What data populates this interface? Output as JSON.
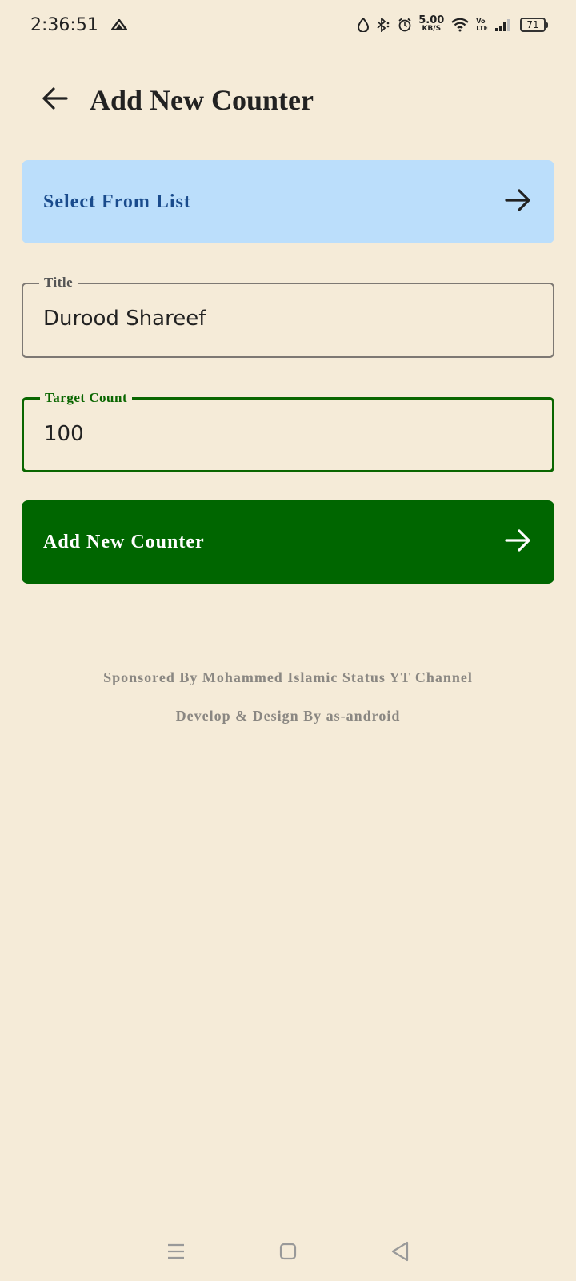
{
  "status_bar": {
    "time": "2:36:51",
    "net_speed_value": "5.00",
    "net_speed_unit": "KB/S",
    "volte_top": "Vo",
    "volte_bottom": "LTE",
    "battery": "71"
  },
  "app_bar": {
    "title": "Add New Counter",
    "back_icon": "arrow-left-icon"
  },
  "select_list": {
    "label": "Select From List",
    "icon": "arrow-right-icon"
  },
  "form": {
    "title_field": {
      "label": "Title",
      "value": "Durood Shareef"
    },
    "target_field": {
      "label": "Target Count",
      "value": "100"
    }
  },
  "submit": {
    "label": "Add New Counter",
    "icon": "arrow-right-icon"
  },
  "credits": {
    "sponsor": "Sponsored By Mohammed Islamic Status YT Channel",
    "developer": "Develop & Design By as-android"
  },
  "colors": {
    "background": "#f5ebd8",
    "select_button": "#bbdefb",
    "select_text": "#1a4b8c",
    "primary_green": "#006600",
    "focused_outline": "#0a6600",
    "credits_text": "#8a8782"
  },
  "nav_bar": {
    "items": [
      "menu-icon",
      "home-icon",
      "back-icon"
    ]
  }
}
